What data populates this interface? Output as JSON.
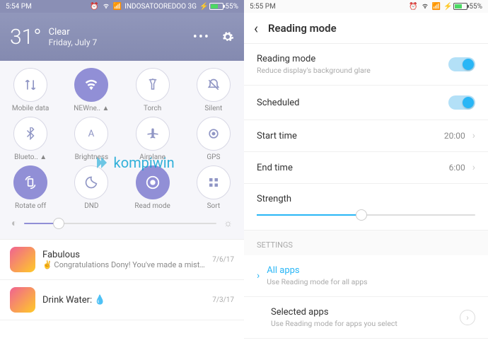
{
  "left": {
    "status": {
      "time": "5:54 PM",
      "carrier": "INDOSATOOREDOO 3G",
      "battery": "55%"
    },
    "weather": {
      "temp": "31°",
      "cond": "Clear",
      "date": "Friday, July 7"
    },
    "toggles": [
      {
        "label": "Mobile data",
        "icon": "mobile-data"
      },
      {
        "label": "NEWne.. ▲",
        "icon": "wifi",
        "active": true
      },
      {
        "label": "Torch",
        "icon": "torch"
      },
      {
        "label": "Silent",
        "icon": "silent"
      },
      {
        "label": "Blueto.. ▲",
        "icon": "bluetooth"
      },
      {
        "label": "Brightness",
        "icon": "brightness"
      },
      {
        "label": "Airplane",
        "icon": "airplane"
      },
      {
        "label": "GPS",
        "icon": "gps"
      },
      {
        "label": "Rotate off",
        "icon": "rotate",
        "active": true
      },
      {
        "label": "DND",
        "icon": "dnd"
      },
      {
        "label": "Read mode",
        "icon": "readmode",
        "active": true
      },
      {
        "label": "Sort",
        "icon": "sort"
      }
    ],
    "notifs": [
      {
        "title": "Fabulous",
        "text": "✌ Congratulations Dony! You've made a mistak..",
        "time": "7/6/17"
      },
      {
        "title": "Drink Water: 💧",
        "text": "",
        "time": "7/3/17"
      }
    ]
  },
  "right": {
    "status": {
      "time": "5:55 PM",
      "battery": "55%"
    },
    "header": "Reading mode",
    "items": {
      "reading": {
        "title": "Reading mode",
        "sub": "Reduce display's background glare"
      },
      "scheduled": {
        "title": "Scheduled"
      },
      "start": {
        "title": "Start time",
        "value": "20:00"
      },
      "end": {
        "title": "End time",
        "value": "6:00"
      },
      "strength": {
        "title": "Strength"
      },
      "section": "SETTINGS",
      "allapps": {
        "title": "All apps",
        "sub": "Use Reading mode for all apps"
      },
      "selected": {
        "title": "Selected apps",
        "sub": "Use Reading mode for apps you select"
      }
    }
  },
  "watermark": "kompiwin"
}
